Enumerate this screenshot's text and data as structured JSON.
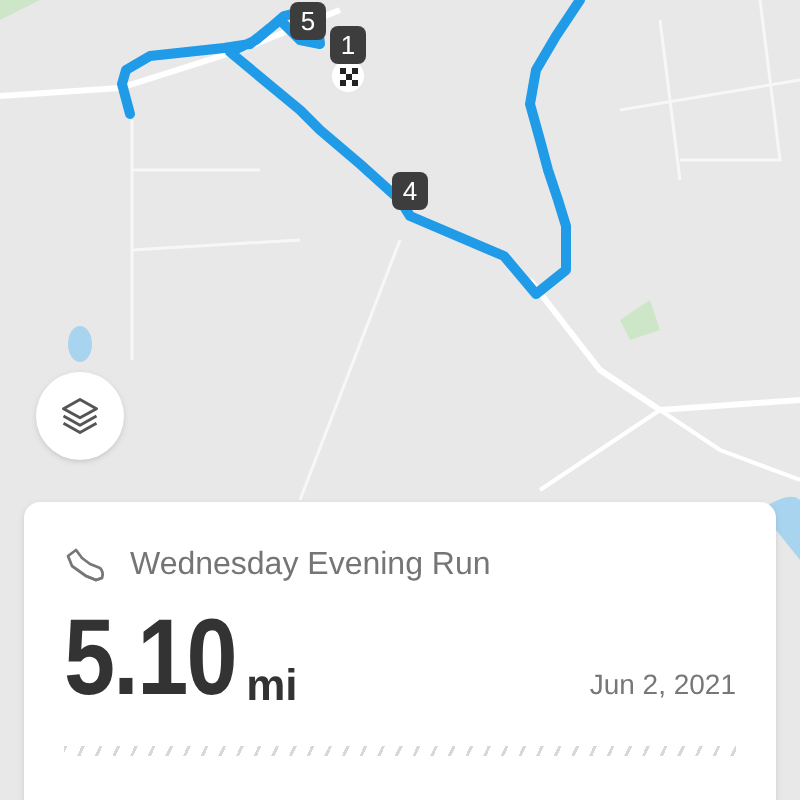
{
  "markers": [
    {
      "label": "5",
      "finish": false
    },
    {
      "label": "1",
      "finish": true
    },
    {
      "label": "4",
      "finish": false
    }
  ],
  "activity": {
    "title": "Wednesday Evening Run",
    "distance": "5.10",
    "unit": "mi",
    "date": "Jun 2, 2021"
  }
}
